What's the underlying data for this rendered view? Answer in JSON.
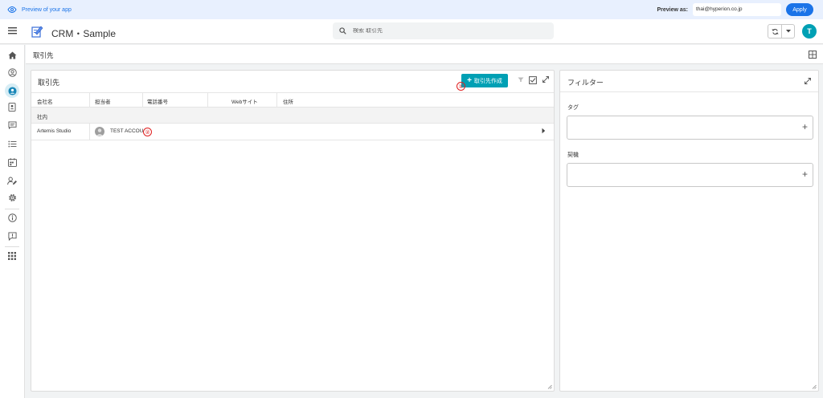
{
  "preview": {
    "label": "Preview of your app",
    "preview_as_label": "Preview as:",
    "email": "thai@hyperion.co.jp",
    "apply_label": "Apply"
  },
  "header": {
    "title": "CRM・Sample",
    "search_placeholder": "検索 取引先",
    "avatar_initial": "T"
  },
  "nav": {
    "items": [
      "home-icon",
      "profile-icon",
      "accounts-icon",
      "contacts-icon",
      "chat-icon",
      "tasks-icon",
      "calendar-icon",
      "user-edit-icon",
      "settings-icon",
      "info-icon",
      "feedback-icon",
      "apps-grid-icon"
    ],
    "active": "accounts-icon"
  },
  "breadcrumb": {
    "title": "取引先"
  },
  "accounts_panel": {
    "title": "取引先",
    "create_button_label": "取引先作成",
    "marker_1": "①",
    "marker_2": "②",
    "columns": [
      "会社名",
      "担当者",
      "電話番号",
      "Webサイト",
      "住所"
    ],
    "group_label": "社内",
    "rows": [
      {
        "company": "Artemis Studio",
        "owner": "TEST ACCOU"
      }
    ]
  },
  "filter_panel": {
    "title": "フィルター",
    "tag_label": "タグ",
    "deal_label": "契機"
  },
  "colors": {
    "accent": "#00a0b4",
    "preview_blue": "#1a73e8",
    "marker_red": "#e02020"
  }
}
